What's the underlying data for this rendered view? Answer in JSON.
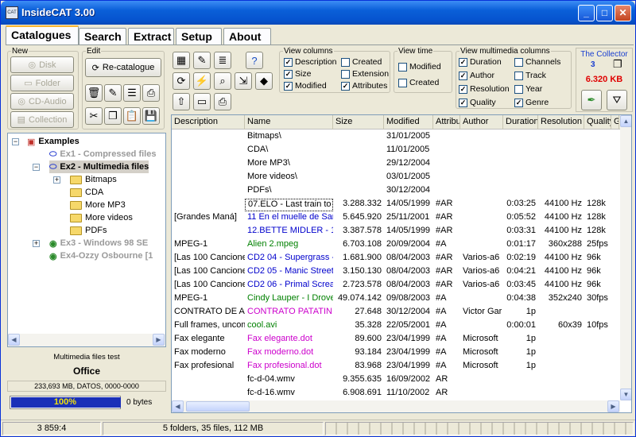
{
  "app": {
    "title": "InsideCAT 3.00",
    "icon_label": "CAT"
  },
  "tabs": [
    "Catalogues",
    "Search",
    "Extract",
    "Setup",
    "About"
  ],
  "new_group": {
    "legend": "New",
    "buttons": [
      "Disk",
      "Folder",
      "CD-Audio",
      "Collection"
    ]
  },
  "edit_group": {
    "legend": "Edit",
    "recatalogue": "Re-catalogue"
  },
  "view_columns": {
    "legend": "View columns",
    "items": [
      {
        "label": "Description",
        "checked": "✓"
      },
      {
        "label": "Size",
        "checked": "✓"
      },
      {
        "label": "Modified",
        "checked": "✓"
      },
      {
        "label": "Created",
        "checked": ""
      },
      {
        "label": "Extension",
        "checked": ""
      },
      {
        "label": "Attributes",
        "checked": "✓"
      }
    ]
  },
  "view_time": {
    "legend": "View time",
    "items": [
      {
        "label": "Modified",
        "checked": ""
      },
      {
        "label": "Created",
        "checked": ""
      }
    ]
  },
  "view_mm": {
    "legend": "View multimedia columns",
    "items": [
      {
        "label": "Duration",
        "checked": "✓"
      },
      {
        "label": "Author",
        "checked": "✓"
      },
      {
        "label": "Resolution",
        "checked": "✓"
      },
      {
        "label": "Quality",
        "checked": "✓"
      },
      {
        "label": "Channels",
        "checked": ""
      },
      {
        "label": "Track",
        "checked": ""
      },
      {
        "label": "Year",
        "checked": ""
      },
      {
        "label": "Genre",
        "checked": "✓"
      }
    ]
  },
  "collector": {
    "title": "The Collector",
    "count": "3",
    "size": "6.320 KB"
  },
  "tree": {
    "root": "Examples",
    "ex1": "Ex1 - Compressed files",
    "ex2": "Ex2 - Multimedia files",
    "folders": [
      "Bitmaps",
      "CDA",
      "More MP3",
      "More videos",
      "PDFs"
    ],
    "ex3": "Ex3 - Windows 98 SE",
    "ex4": "Ex4-Ozzy Osbourne [1"
  },
  "info": {
    "caption": "Multimedia files test",
    "location": "Office",
    "disk": "233,693 MB, DATOS, 0000-0000",
    "progress": "100%",
    "progress_value": 100,
    "bytes": "0 bytes"
  },
  "columns": [
    "Description",
    "Name",
    "Size",
    "Modified",
    "Attribu",
    "Author",
    "Duration",
    "Resolution",
    "Quality",
    "G"
  ],
  "rows": [
    [
      "",
      "Bitmaps\\",
      "",
      "31/01/2005",
      "",
      "",
      "",
      "",
      ""
    ],
    [
      "",
      "CDA\\",
      "",
      "11/01/2005",
      "",
      "",
      "",
      "",
      ""
    ],
    [
      "",
      "More MP3\\",
      "",
      "29/12/2004",
      "",
      "",
      "",
      "",
      ""
    ],
    [
      "",
      "More videos\\",
      "",
      "03/01/2005",
      "",
      "",
      "",
      "",
      ""
    ],
    [
      "",
      "PDFs\\",
      "",
      "30/12/2004",
      "",
      "",
      "",
      "",
      ""
    ],
    [
      "",
      "07.ELO - Last train to l",
      "3.288.332",
      "14/05/1999",
      "#AR",
      "",
      "0:03:25",
      "44100 Hz",
      "128k"
    ],
    [
      "[Grandes Maná]",
      "11 En el muelle de San",
      "5.645.920",
      "25/11/2001",
      "#AR",
      "",
      "0:05:52",
      "44100 Hz",
      "128k"
    ],
    [
      "",
      "12.BETTE MIDLER - 1",
      "3.387.578",
      "14/05/1999",
      "#AR",
      "",
      "0:03:31",
      "44100 Hz",
      "128k"
    ],
    [
      "MPEG-1",
      "Alien 2.mpeg",
      "6.703.108",
      "20/09/2004",
      "#A",
      "",
      "0:01:17",
      "360x288",
      "25fps"
    ],
    [
      "[Las 100 Canciones",
      "CD2 04 - Supergrass -",
      "1.681.900",
      "08/04/2003",
      "#AR",
      "Varios-a6",
      "0:02:19",
      "44100 Hz",
      "96k"
    ],
    [
      "[Las 100 Canciones",
      "CD2 05 - Manic Street",
      "3.150.130",
      "08/04/2003",
      "#AR",
      "Varios-a6",
      "0:04:21",
      "44100 Hz",
      "96k"
    ],
    [
      "[Las 100 Canciones",
      "CD2 06 - Primal Screar",
      "2.723.578",
      "08/04/2003",
      "#AR",
      "Varios-a6",
      "0:03:45",
      "44100 Hz",
      "96k"
    ],
    [
      "MPEG-1",
      "Cindy Lauper - I Drove",
      "49.074.142",
      "09/08/2003",
      "#A",
      "",
      "0:04:38",
      "352x240",
      "30fps"
    ],
    [
      "CONTRATO DE A",
      "CONTRATO PATATIN",
      "27.648",
      "30/12/2004",
      "#A",
      "Victor Gar",
      "1p",
      "",
      ""
    ],
    [
      "Full frames, uncom",
      "cool.avi",
      "35.328",
      "22/05/2001",
      "#A",
      "",
      "0:00:01",
      "60x39",
      "10fps"
    ],
    [
      "Fax elegante",
      "Fax elegante.dot",
      "89.600",
      "23/04/1999",
      "#A",
      "Microsoft",
      "1p",
      "",
      ""
    ],
    [
      "Fax moderno",
      "Fax moderno.dot",
      "93.184",
      "23/04/1999",
      "#A",
      "Microsoft",
      "1p",
      "",
      ""
    ],
    [
      "Fax profesional",
      "Fax profesional.dot",
      "83.968",
      "23/04/1999",
      "#A",
      "Microsoft",
      "1p",
      "",
      ""
    ],
    [
      "",
      "fc-d-04.wmv",
      "9.355.635",
      "16/09/2002",
      "AR",
      "",
      "",
      "",
      ""
    ],
    [
      "",
      "fc-d-16.wmv",
      "6.908.691",
      "11/10/2002",
      "AR",
      "",
      "",
      "",
      ""
    ]
  ],
  "name_colors": [
    "#000",
    "#000",
    "#000",
    "#000",
    "#000",
    "#000",
    "#0000cc",
    "#0000cc",
    "#008000",
    "#0000cc",
    "#0000cc",
    "#0000cc",
    "#008000",
    "#cc00cc",
    "#008000",
    "#cc00cc",
    "#cc00cc",
    "#cc00cc",
    "#000",
    "#000"
  ],
  "status": {
    "pos": "3 859:4",
    "summary": "5 folders, 35 files, 112 MB"
  }
}
